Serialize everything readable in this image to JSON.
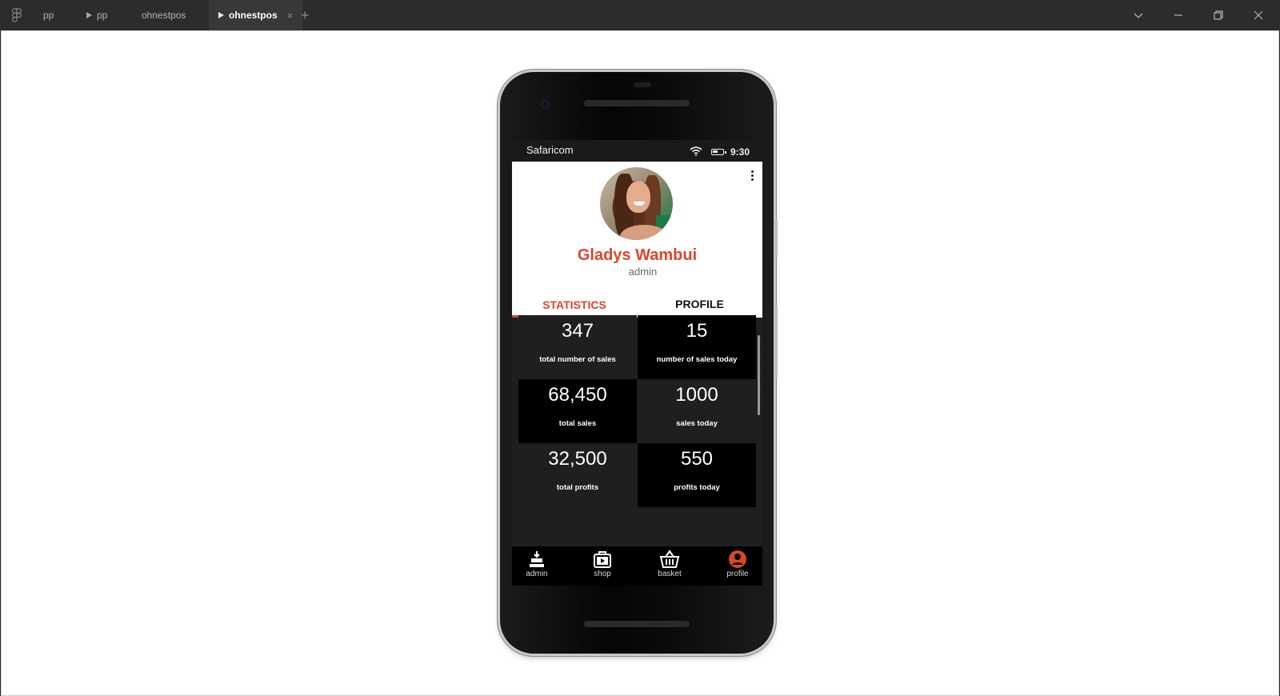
{
  "titlebar": {
    "tabs": [
      {
        "label": "pp",
        "play": false,
        "active": false
      },
      {
        "label": "pp",
        "play": true,
        "active": false
      },
      {
        "label": "ohnestpos",
        "play": false,
        "active": false
      },
      {
        "label": "ohnestpos",
        "play": true,
        "active": true
      }
    ],
    "close_symbol": "×",
    "add_symbol": "+"
  },
  "statusbar": {
    "carrier": "Safaricom",
    "time": "9:30"
  },
  "profile": {
    "name": "Gladys Wambui",
    "role": "admin"
  },
  "tabs": {
    "statistics": "STATISTICS",
    "profile": "PROFILE"
  },
  "stats": [
    {
      "value": "347",
      "label": "total number of sales"
    },
    {
      "value": "15",
      "label": "number of sales today"
    },
    {
      "value": "68,450",
      "label": "total sales"
    },
    {
      "value": "1000",
      "label": "sales today"
    },
    {
      "value": "32,500",
      "label": "total profits"
    },
    {
      "value": "550",
      "label": "profits today"
    }
  ],
  "nav": {
    "admin": "admin",
    "shop": "shop",
    "basket": "basket",
    "profile": "profile"
  },
  "colors": {
    "accent": "#d9472b",
    "titlebar": "#2c2c2c",
    "screen_bg": "#1f1f1f"
  }
}
